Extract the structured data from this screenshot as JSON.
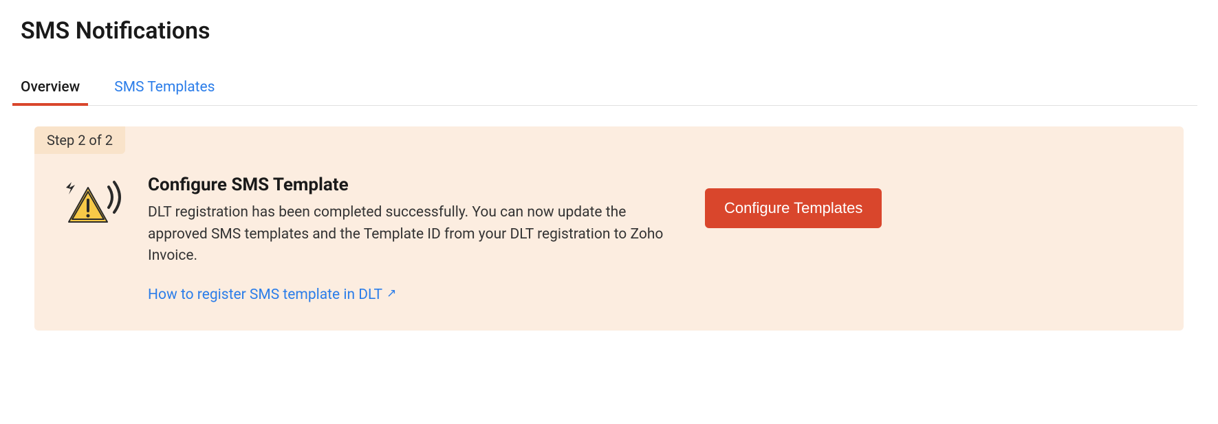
{
  "header": {
    "title": "SMS Notifications"
  },
  "tabs": {
    "overview": "Overview",
    "sms_templates": "SMS Templates"
  },
  "panel": {
    "step_label": "Step 2 of 2",
    "title": "Configure SMS Template",
    "description": "DLT registration has been completed successfully. You can now update the approved SMS templates and the Template ID from your DLT registration to Zoho Invoice.",
    "help_link": "How to register SMS template in DLT",
    "action_button": "Configure Templates"
  }
}
